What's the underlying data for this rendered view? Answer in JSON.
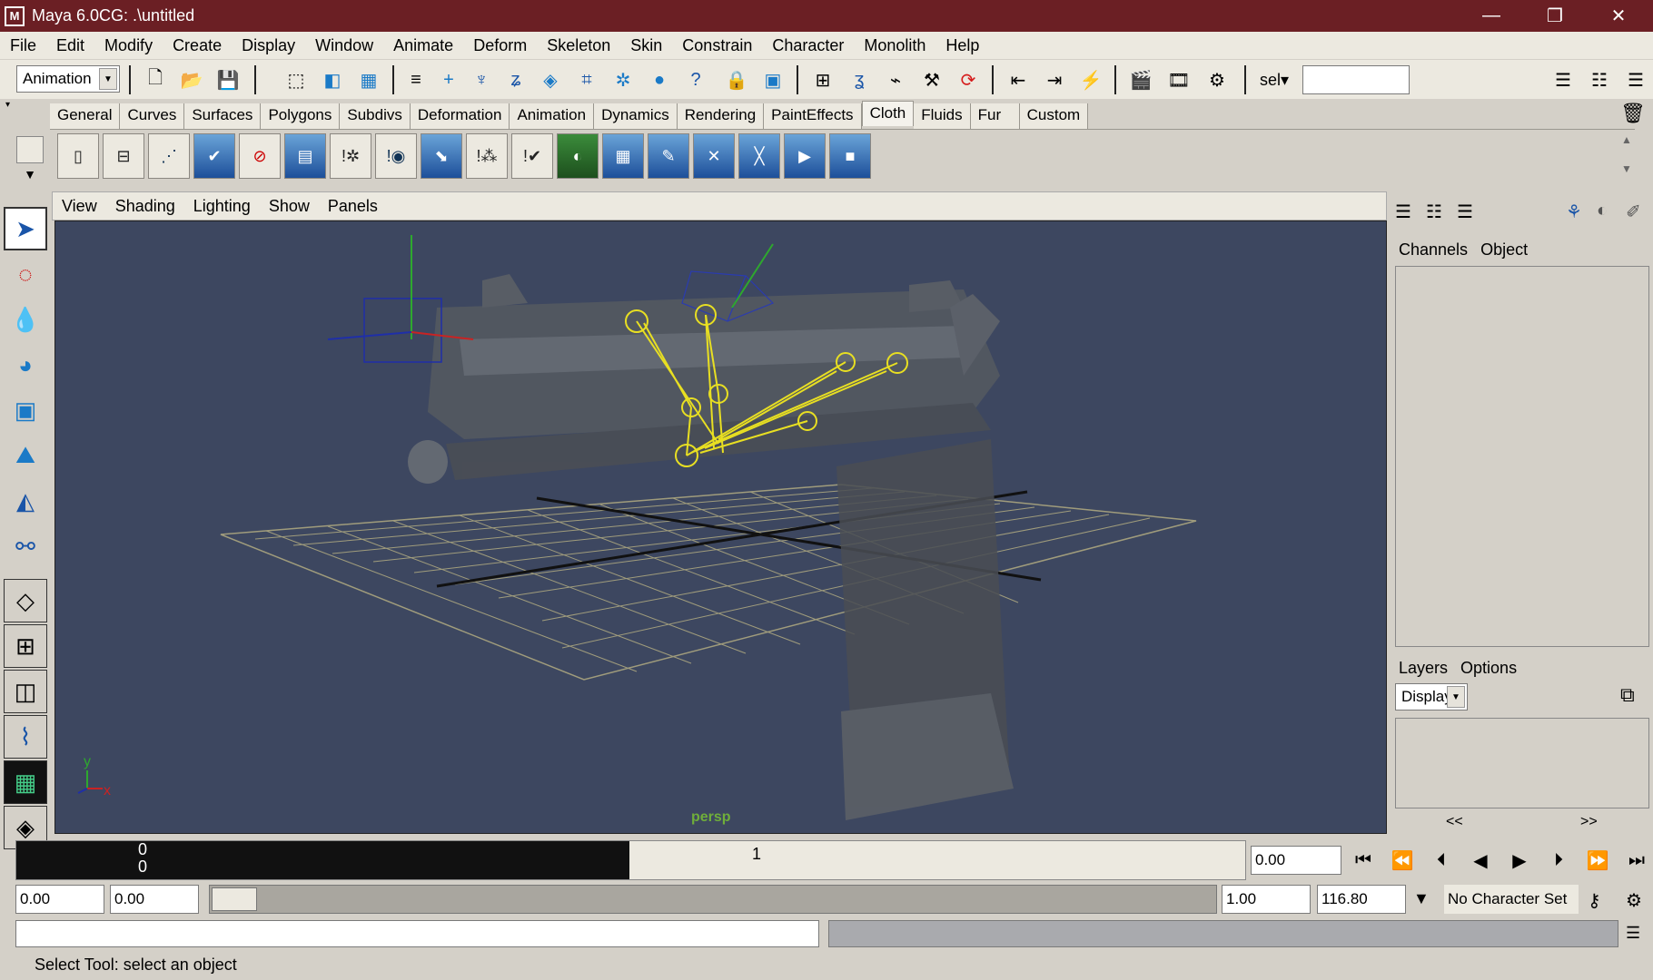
{
  "window": {
    "title": "Maya 6.0CG: .\\untitled",
    "logo": "M"
  },
  "menubar": [
    "File",
    "Edit",
    "Modify",
    "Create",
    "Display",
    "Window",
    "Animate",
    "Deform",
    "Skeleton",
    "Skin",
    "Constrain",
    "Character",
    "Monolith",
    "Help"
  ],
  "toolbar": {
    "mode": "Animation",
    "sel_label": "sel▾",
    "sel_value": ""
  },
  "shelf": {
    "tabs": [
      "General",
      "Curves",
      "Surfaces",
      "Polygons",
      "Subdivs",
      "Deformation",
      "Animation",
      "Dynamics",
      "Rendering",
      "PaintEffects",
      "Cloth",
      "Fluids",
      "Fur",
      "Custom"
    ],
    "active_tab": "Cloth"
  },
  "viewport": {
    "menu": [
      "View",
      "Shading",
      "Lighting",
      "Show",
      "Panels"
    ],
    "camera_label": "persp",
    "axis_x": "x",
    "axis_y": "y"
  },
  "channelbox": {
    "tabs": [
      "Channels",
      "Object"
    ]
  },
  "layers": {
    "tabs": [
      "Layers",
      "Options"
    ],
    "display": "Display",
    "prev": "<<",
    "next": ">>"
  },
  "timeline": {
    "start_frame": "0",
    "marker": "1",
    "current_time": "0.00",
    "range_start": "0.00",
    "range_start2": "0.00",
    "range_end": "1.00",
    "range_end2": "116.80",
    "character_set": "No Character Set"
  },
  "helpline": "Select Tool: select an object"
}
